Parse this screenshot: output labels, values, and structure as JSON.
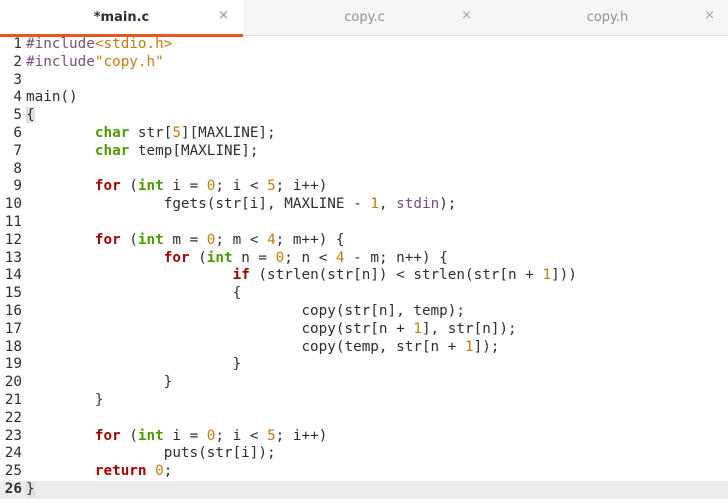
{
  "tabs": [
    {
      "label": "*main.c",
      "active": true
    },
    {
      "label": "copy.c",
      "active": false
    },
    {
      "label": "copy.h",
      "active": false
    }
  ],
  "close_glyph": "×",
  "editor": {
    "current_line": 26,
    "lines": [
      [
        [
          "pp",
          "#include"
        ],
        [
          "str",
          "<stdio.h>"
        ]
      ],
      [
        [
          "pp",
          "#include"
        ],
        [
          "str",
          "\"copy.h\""
        ]
      ],
      [],
      [
        [
          "t",
          "main()"
        ]
      ],
      [
        [
          "hl",
          "{"
        ]
      ],
      [
        [
          "t",
          "\t"
        ],
        [
          "type",
          "char"
        ],
        [
          "t",
          " str["
        ],
        [
          "num",
          "5"
        ],
        [
          "t",
          "][MAXLINE];"
        ]
      ],
      [
        [
          "t",
          "\t"
        ],
        [
          "type",
          "char"
        ],
        [
          "t",
          " temp[MAXLINE];"
        ]
      ],
      [],
      [
        [
          "t",
          "\t"
        ],
        [
          "kw",
          "for"
        ],
        [
          "t",
          " ("
        ],
        [
          "type",
          "int"
        ],
        [
          "t",
          " i = "
        ],
        [
          "num",
          "0"
        ],
        [
          "t",
          "; i < "
        ],
        [
          "num",
          "5"
        ],
        [
          "t",
          "; i++)"
        ]
      ],
      [
        [
          "t",
          "\t\tfgets(str[i], MAXLINE - "
        ],
        [
          "num",
          "1"
        ],
        [
          "t",
          ", "
        ],
        [
          "pp",
          "stdin"
        ],
        [
          "t",
          ");"
        ]
      ],
      [],
      [
        [
          "t",
          "\t"
        ],
        [
          "kw",
          "for"
        ],
        [
          "t",
          " ("
        ],
        [
          "type",
          "int"
        ],
        [
          "t",
          " m = "
        ],
        [
          "num",
          "0"
        ],
        [
          "t",
          "; m < "
        ],
        [
          "num",
          "4"
        ],
        [
          "t",
          "; m++) {"
        ]
      ],
      [
        [
          "t",
          "\t\t"
        ],
        [
          "kw",
          "for"
        ],
        [
          "t",
          " ("
        ],
        [
          "type",
          "int"
        ],
        [
          "t",
          " n = "
        ],
        [
          "num",
          "0"
        ],
        [
          "t",
          "; n < "
        ],
        [
          "num",
          "4"
        ],
        [
          "t",
          " - m; n++) {"
        ]
      ],
      [
        [
          "t",
          "\t\t\t"
        ],
        [
          "kw",
          "if"
        ],
        [
          "t",
          " (strlen(str[n]) < strlen(str[n + "
        ],
        [
          "num",
          "1"
        ],
        [
          "t",
          "]))"
        ]
      ],
      [
        [
          "t",
          "\t\t\t{"
        ]
      ],
      [
        [
          "t",
          "\t\t\t\tcopy(str[n], temp);"
        ]
      ],
      [
        [
          "t",
          "\t\t\t\tcopy(str[n + "
        ],
        [
          "num",
          "1"
        ],
        [
          "t",
          "], str[n]);"
        ]
      ],
      [
        [
          "t",
          "\t\t\t\tcopy(temp, str[n + "
        ],
        [
          "num",
          "1"
        ],
        [
          "t",
          "]);"
        ]
      ],
      [
        [
          "t",
          "\t\t\t}"
        ]
      ],
      [
        [
          "t",
          "\t\t}"
        ]
      ],
      [
        [
          "t",
          "\t}"
        ]
      ],
      [],
      [
        [
          "t",
          "\t"
        ],
        [
          "kw",
          "for"
        ],
        [
          "t",
          " ("
        ],
        [
          "type",
          "int"
        ],
        [
          "t",
          " i = "
        ],
        [
          "num",
          "0"
        ],
        [
          "t",
          "; i < "
        ],
        [
          "num",
          "5"
        ],
        [
          "t",
          "; i++)"
        ]
      ],
      [
        [
          "t",
          "\t\tputs(str[i]);"
        ]
      ],
      [
        [
          "t",
          "\t"
        ],
        [
          "kw",
          "return"
        ],
        [
          "t",
          " "
        ],
        [
          "num",
          "0"
        ],
        [
          "t",
          ";"
        ]
      ],
      [
        [
          "hl",
          "}"
        ]
      ]
    ]
  }
}
